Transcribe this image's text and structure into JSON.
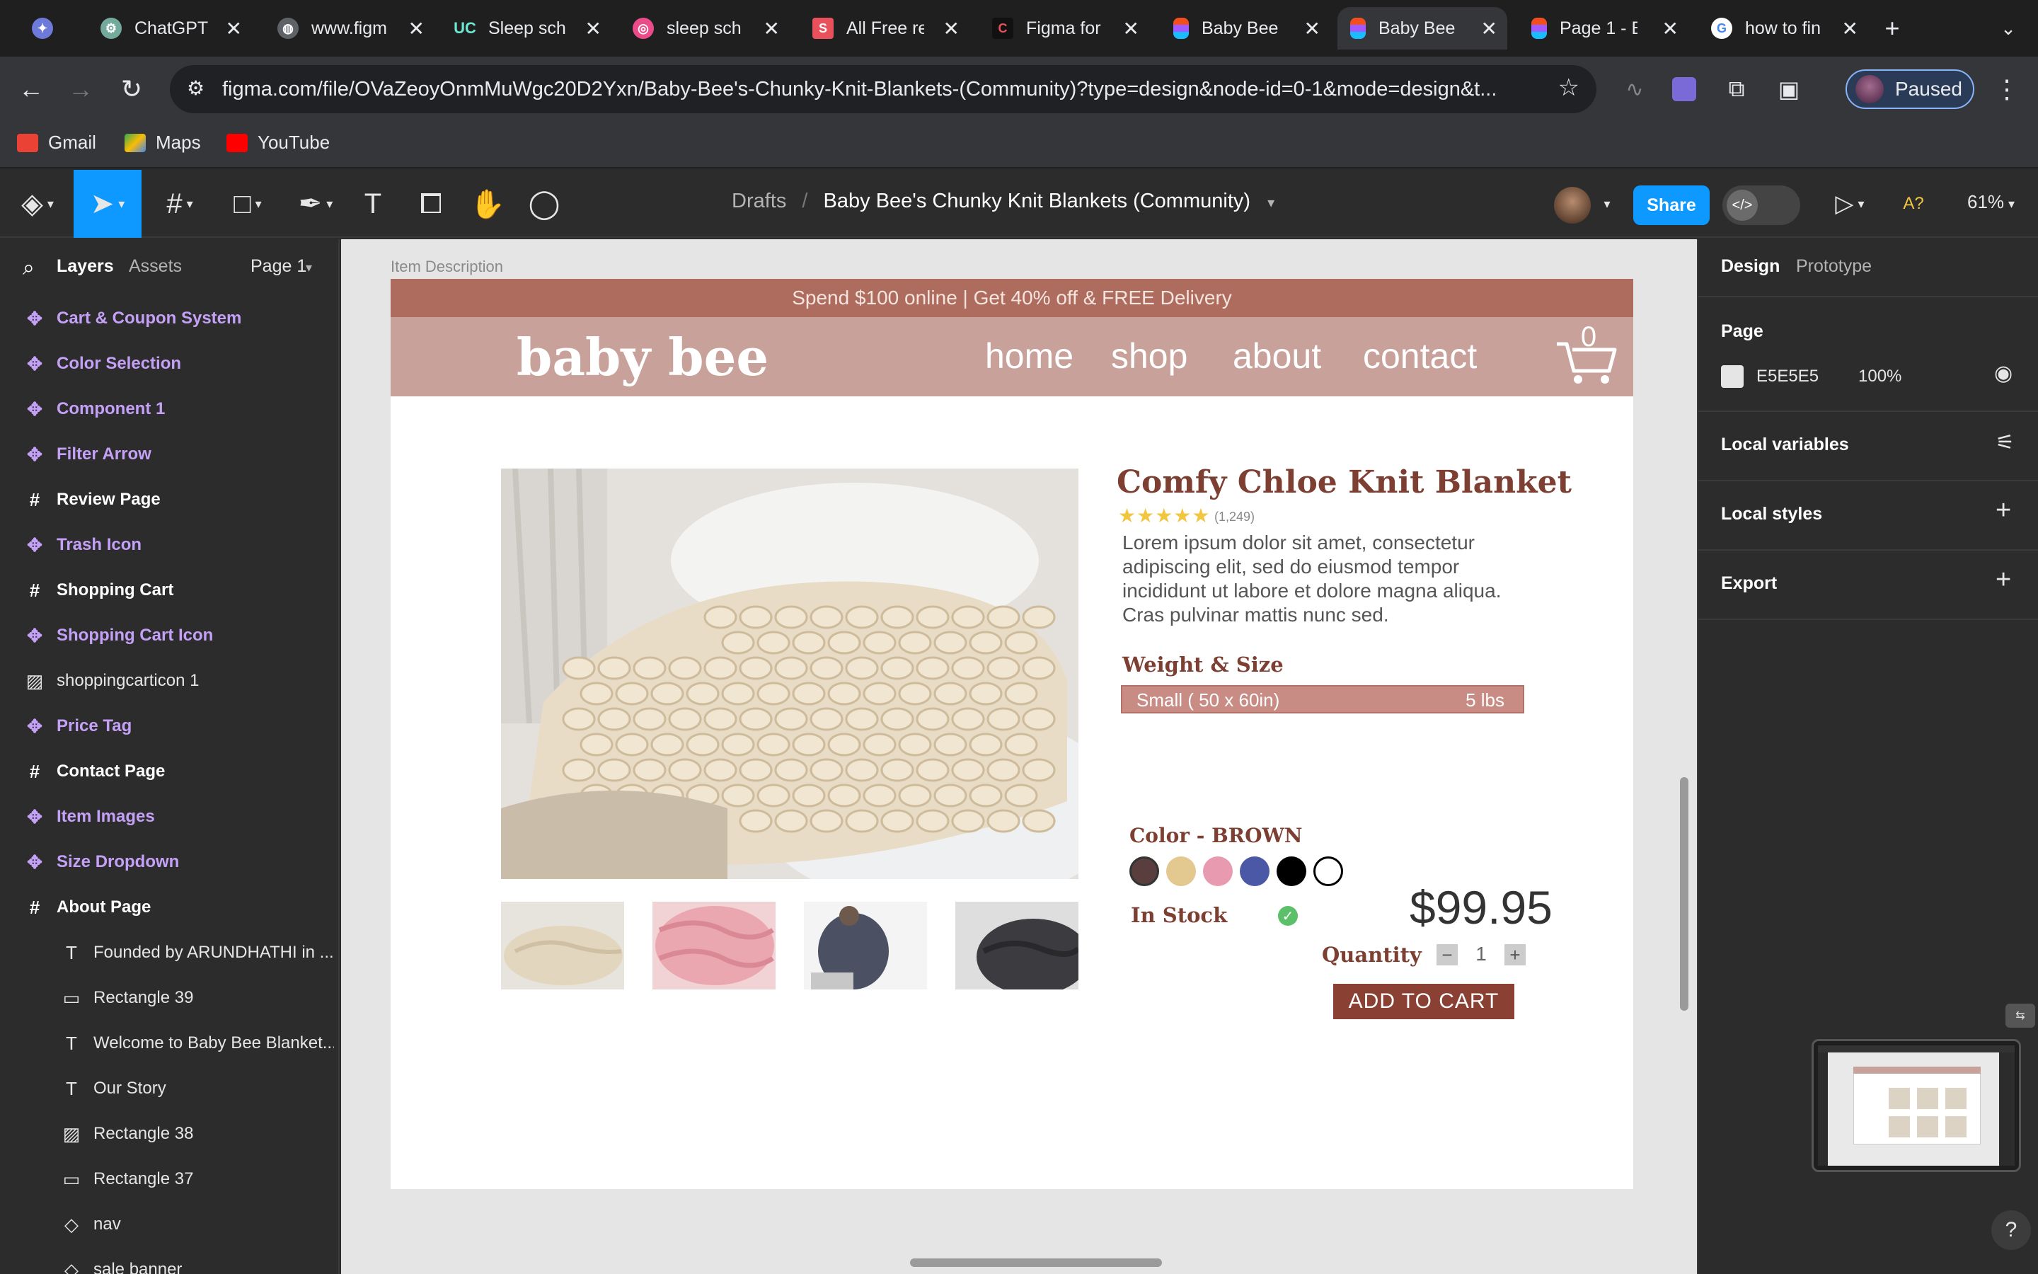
{
  "browser": {
    "tabs": [
      {
        "title": "",
        "icon": "perplexity-icon",
        "color": "#6e7ad9"
      },
      {
        "title": "ChatGPT",
        "icon": "chatgpt-icon",
        "color": "#74aa9c"
      },
      {
        "title": "www.figm",
        "icon": "globe-icon",
        "color": "#9aa0a6"
      },
      {
        "title": "Sleep sch",
        "icon": "uc-icon",
        "color": "#1f1f1f"
      },
      {
        "title": "sleep sch",
        "icon": "dribbble-icon",
        "color": "#ea4c89"
      },
      {
        "title": "All Free re",
        "icon": "s-icon",
        "color": "#e8505b"
      },
      {
        "title": "Figma for",
        "icon": "c-icon",
        "color": "#111111"
      },
      {
        "title": "Baby Bee",
        "icon": "figma-icon",
        "color": "#a259ff"
      },
      {
        "title": "Baby Bee",
        "icon": "figma-icon",
        "color": "#a259ff",
        "active": true
      },
      {
        "title": "Page 1 - E",
        "icon": "figma-icon",
        "color": "#a259ff"
      },
      {
        "title": "how to fin",
        "icon": "google-icon",
        "color": "#4285f4"
      }
    ],
    "url": "figma.com/file/OVaZeoyOnmMuWgc20D2Yxn/Baby-Bee's-Chunky-Knit-Blankets-(Community)?type=design&node-id=0-1&mode=design&t...",
    "profile_status": "Paused",
    "bookmarks": [
      {
        "label": "Gmail",
        "color": "#ea4335"
      },
      {
        "label": "Maps",
        "color": "#34a853"
      },
      {
        "label": "YouTube",
        "color": "#ff0000"
      }
    ]
  },
  "figma": {
    "breadcrumb_parent": "Drafts",
    "breadcrumb_sep": "/",
    "file_name": "Baby Bee's Chunky Knit Blankets (Community)",
    "share_label": "Share",
    "zoom": "61%",
    "dev_icon": "</>",
    "font_alert": "A?",
    "left_panel": {
      "tab_layers": "Layers",
      "tab_assets": "Assets",
      "page_selector": "Page 1",
      "layers": [
        {
          "name": "Cart & Coupon System",
          "kind": "comp"
        },
        {
          "name": "Color Selection",
          "kind": "comp"
        },
        {
          "name": "Component 1",
          "kind": "comp"
        },
        {
          "name": "Filter Arrow",
          "kind": "comp"
        },
        {
          "name": "Review Page",
          "kind": "frame"
        },
        {
          "name": "Trash Icon",
          "kind": "comp"
        },
        {
          "name": "Shopping Cart",
          "kind": "frame"
        },
        {
          "name": "Shopping Cart Icon",
          "kind": "comp"
        },
        {
          "name": "shoppingcarticon 1",
          "kind": "image"
        },
        {
          "name": "Price Tag",
          "kind": "comp"
        },
        {
          "name": "Contact Page",
          "kind": "frame"
        },
        {
          "name": "Item Images",
          "kind": "comp"
        },
        {
          "name": "Size Dropdown",
          "kind": "comp"
        },
        {
          "name": "About Page",
          "kind": "frame"
        },
        {
          "name": "Founded by ARUNDHATHI in ...",
          "kind": "text"
        },
        {
          "name": "Rectangle 39",
          "kind": "rect"
        },
        {
          "name": "Welcome to Baby Bee Blanket...",
          "kind": "text"
        },
        {
          "name": "Our Story",
          "kind": "text"
        },
        {
          "name": "Rectangle 38",
          "kind": "image"
        },
        {
          "name": "Rectangle 37",
          "kind": "rect"
        },
        {
          "name": "nav",
          "kind": "instance"
        },
        {
          "name": "sale banner",
          "kind": "instance"
        }
      ]
    },
    "right_panel": {
      "tab_design": "Design",
      "tab_prototype": "Prototype",
      "page_heading": "Page",
      "page_color": "E5E5E5",
      "page_opacity": "100%",
      "local_variables": "Local variables",
      "local_styles": "Local styles",
      "export": "Export",
      "help": "?"
    }
  },
  "design": {
    "frame_label": "Item Description",
    "promo": "Spend $100 online | Get 40% off & FREE Delivery",
    "logo": "baby bee",
    "nav": [
      "home",
      "shop",
      "about",
      "contact"
    ],
    "cart_count": "0",
    "product": {
      "title": "Comfy Chloe Knit Blanket",
      "stars": "★★★★★",
      "rating": 5,
      "reviews": "(1,249)",
      "description": "Lorem ipsum dolor sit amet, consectetur adipiscing elit, sed do eiusmod tempor incididunt ut labore et dolore magna aliqua. Cras pulvinar mattis nunc sed.",
      "weight_size_heading": "Weight & Size",
      "size_option": "Small ( 50 x 60in)",
      "weight": "5 lbs",
      "color_heading": "Color - BROWN",
      "swatches": [
        "#5a3d3d",
        "#e3c98f",
        "#e89ab0",
        "#4a58a6",
        "#000000",
        "#ffffff"
      ],
      "stock": "In Stock",
      "price": "$99.95",
      "quantity_label": "Quantity",
      "quantity": "1",
      "minus": "−",
      "plus": "+",
      "add_to_cart": "ADD TO CART",
      "thumbnails": [
        "cream",
        "pink",
        "grey",
        "charcoal"
      ]
    }
  },
  "colors": {
    "figma_blue": "#0d99ff",
    "component_purple": "#c4a1f7",
    "brand_rose": "#c8a19a",
    "brand_brown": "#7e3f33"
  }
}
